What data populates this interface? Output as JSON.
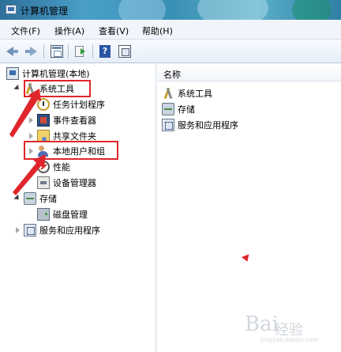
{
  "window": {
    "title": "计算机管理"
  },
  "menu": [
    {
      "label": "文件(F)"
    },
    {
      "label": "操作(A)"
    },
    {
      "label": "查看(V)"
    },
    {
      "label": "帮助(H)"
    }
  ],
  "toolbar": {
    "icons": [
      "back-arrow-icon",
      "forward-arrow-icon",
      "console-tree-icon",
      "export-list-icon",
      "help-icon",
      "show-pane-icon"
    ]
  },
  "tree": {
    "root": "计算机管理(本地)",
    "system_tools": "系统工具",
    "task_scheduler": "任务计划程序",
    "event_viewer": "事件查看器",
    "shared_folders": "共享文件夹",
    "local_users_groups": "本地用户和组",
    "performance": "性能",
    "device_manager": "设备管理器",
    "storage": "存储",
    "disk_management": "磁盘管理",
    "services_apps": "服务和应用程序"
  },
  "list": {
    "column_name": "名称",
    "items": [
      "系统工具",
      "存储",
      "服务和应用程序"
    ]
  },
  "watermark": {
    "glyph": "Bai",
    "text": "经验",
    "url": "jingyan.baidu.com"
  },
  "colors": {
    "highlight": "#e0262b",
    "titlebar": "#3a8fb5"
  }
}
